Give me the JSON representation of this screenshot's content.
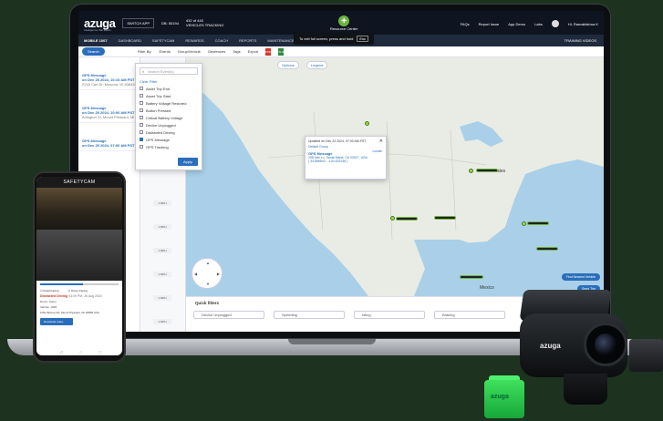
{
  "topbar": {
    "logo": "azuga",
    "logo_tag": "Intelligence that works",
    "account_select": "SWITCH APP",
    "account_id": "DB: 50194",
    "vehicles": "432 of 445",
    "vehicles_label": "VEHICLES TRACKING",
    "resource_center": "Resource Center",
    "links": [
      "FAQs",
      "Report Issue",
      "App Demo",
      "Labs"
    ],
    "user": "Hi, Ramaktishna K"
  },
  "toast": {
    "text": "To exit full screen, press and hold",
    "key": "Esc"
  },
  "navbar": {
    "items": [
      "MOBILE 1007",
      "DASHBOARD",
      "SAFETYCAM",
      "REWARDS",
      "COACH",
      "REPORTS",
      "MAINTENANCE",
      "S"
    ],
    "right": "TRAINING VIDEOS"
  },
  "toolbar": {
    "search": "Search",
    "filter_by": "Filter By:",
    "events": "Events",
    "group": "Group/Vehicle",
    "geofences": "Geofences",
    "tags": "Tags",
    "export": "Export",
    "pdf": "PDF",
    "xls": "XLS"
  },
  "filter_panel": {
    "search_placeholder": "Search Event(s)",
    "clear": "Clear Filter",
    "options": [
      {
        "label": "Asset Trip End",
        "checked": false
      },
      {
        "label": "Asset Trip Start",
        "checked": false
      },
      {
        "label": "Battery Voltage Restored",
        "checked": false
      },
      {
        "label": "Button Pressed",
        "checked": false
      },
      {
        "label": "Critical Battery Voltage",
        "checked": false
      },
      {
        "label": "Device Unplugged",
        "checked": false
      },
      {
        "label": "Distracted Driving",
        "checked": false
      },
      {
        "label": "GPS Message",
        "checked": true
      },
      {
        "label": "GPS Tracking",
        "checked": false
      }
    ],
    "apply": "Apply"
  },
  "events_list": [
    {
      "title": "GPS Message",
      "date": "on Dec 25 2024, 10:10 AM PST",
      "sub": "2216 Carl Dr, Moscow, ID 83843"
    },
    {
      "title": "GPS Message",
      "date": "on Dec 25 2024, 10:00 AM PST",
      "sub": "Arlington St, Mount Pleasant, MI"
    },
    {
      "title": "GPS Message",
      "date": "on Dec 25 2024, 07:00 AM PST",
      "sub": ""
    }
  ],
  "card_buttons": [
    "1 MPH",
    "1 MPH",
    "1 MPH",
    "1 MPH",
    "1 MPH",
    "1 MPH"
  ],
  "map": {
    "buttons": [
      "Options",
      "Legend"
    ],
    "labels": {
      "states": "States",
      "mexico": "Mexico"
    },
    "fab_primary": "Find Nearest Vehicle",
    "fab_secondary": "Send Trip"
  },
  "popup": {
    "updated": "Updated on Dec 23 2024, 07:03 AM PST",
    "vehicle": "Default Group",
    "event": "GPS Message",
    "address": "298 Alto Ln, Santa Maria, CA 93427, USA",
    "coords": "( 34.856543 , -120.432148 )",
    "link": "Locate"
  },
  "quick_filters": {
    "title": "Quick filters",
    "items": [
      "Device Unplugged",
      "Speeding",
      "Idling",
      "Braking"
    ]
  },
  "phone": {
    "app_title": "SAFETYCAM",
    "progress": 0.55,
    "cam_front": "Road Facing",
    "cam_rear": "Driver Facing",
    "event": "Distracted Driving",
    "event_time": "04:09 PM, 26 Aug 2024",
    "lines": [
      "Driver: Jason",
      "Vehicle: 1028",
      "1051 Bishop Rd, Mount Pleasant, MI 48858 USA"
    ],
    "download": "Download video",
    "nav": [
      "◁",
      "○",
      "□"
    ]
  },
  "device": {
    "dashcam_logo": "azuga",
    "obd_logo": "azuga"
  },
  "colors": {
    "accent": "#2a6ebb",
    "brand_green": "#6db33f",
    "background": "#1d3320"
  }
}
